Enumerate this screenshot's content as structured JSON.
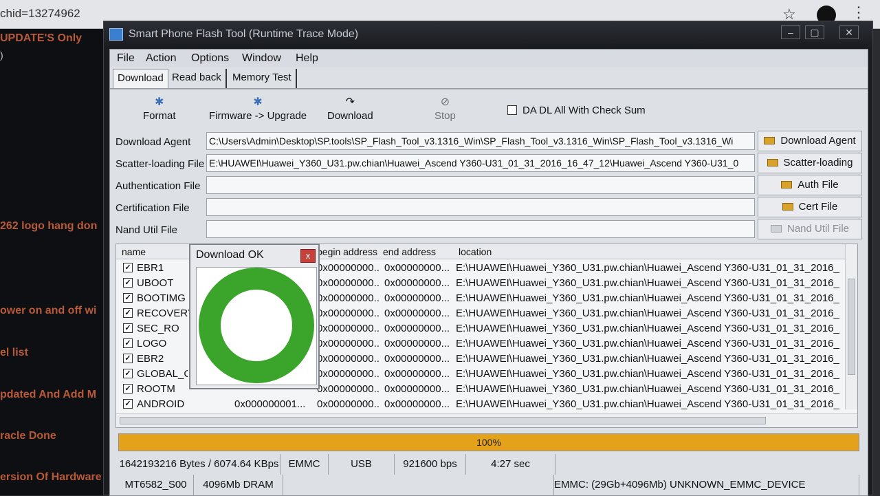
{
  "browser": {
    "url_fragment": "chid=13274962"
  },
  "forum": {
    "lines": [
      {
        "text": "UPDATE'S Only"
      },
      {
        "text": ")"
      },
      {
        "text": "262 logo hang don"
      },
      {
        "text": "ower on and off wi"
      },
      {
        "text": "el list"
      },
      {
        "text": "pdated And Add M"
      },
      {
        "text": "racle Done"
      },
      {
        "text": "ersion Of Hardware"
      }
    ]
  },
  "window": {
    "title": "Smart Phone Flash Tool (Runtime Trace Mode)"
  },
  "menu": [
    "File",
    "Action",
    "Options",
    "Window",
    "Help"
  ],
  "tabs": [
    "Download",
    "Read back",
    "Memory Test"
  ],
  "toolbar": {
    "format": "Format",
    "firmware_upgrade": "Firmware -> Upgrade",
    "download": "Download",
    "stop": "Stop",
    "checksum_label": "DA DL All With Check Sum"
  },
  "files": [
    {
      "label": "Download Agent",
      "value": "C:\\Users\\Admin\\Desktop\\SP.tools\\SP_Flash_Tool_v3.1316_Win\\SP_Flash_Tool_v3.1316_Win\\SP_Flash_Tool_v3.1316_Wi",
      "button": "Download Agent"
    },
    {
      "label": "Scatter-loading File",
      "value": "E:\\HUAWEI\\Huawei_Y360_U31.pw.chian\\Huawei_Ascend Y360-U31_01_31_2016_16_47_12\\Huawei_Ascend Y360-U31_0",
      "button": "Scatter-loading"
    },
    {
      "label": "Authentication File",
      "value": "",
      "button": "Auth File"
    },
    {
      "label": "Certification File",
      "value": "",
      "button": "Cert File"
    },
    {
      "label": "Nand Util File",
      "value": "",
      "button": "Nand Util File"
    }
  ],
  "table": {
    "headers": [
      "name",
      "begin address",
      "end address",
      "location"
    ],
    "rows": [
      {
        "name": "EBR1",
        "begin": "0x00000000...",
        "end": "0x00000000...",
        "location": "E:\\HUAWEI\\Huawei_Y360_U31.pw.chian\\Huawei_Ascend Y360-U31_01_31_2016_16_"
      },
      {
        "name": "UBOOT",
        "begin": "0x00000000...",
        "end": "0x00000000...",
        "location": "E:\\HUAWEI\\Huawei_Y360_U31.pw.chian\\Huawei_Ascend Y360-U31_01_31_2016_16_"
      },
      {
        "name": "BOOTIMG",
        "begin": "0x00000000...",
        "end": "0x00000000...",
        "location": "E:\\HUAWEI\\Huawei_Y360_U31.pw.chian\\Huawei_Ascend Y360-U31_01_31_2016_16_"
      },
      {
        "name": "RECOVERY",
        "begin": "0x00000000...",
        "end": "0x00000000...",
        "location": "E:\\HUAWEI\\Huawei_Y360_U31.pw.chian\\Huawei_Ascend Y360-U31_01_31_2016_16_"
      },
      {
        "name": "SEC_RO",
        "begin": "0x00000000...",
        "end": "0x00000000...",
        "location": "E:\\HUAWEI\\Huawei_Y360_U31.pw.chian\\Huawei_Ascend Y360-U31_01_31_2016_16_"
      },
      {
        "name": "LOGO",
        "begin": "0x00000000...",
        "end": "0x00000000...",
        "location": "E:\\HUAWEI\\Huawei_Y360_U31.pw.chian\\Huawei_Ascend Y360-U31_01_31_2016_16_"
      },
      {
        "name": "EBR2",
        "begin": "0x00000000...",
        "end": "0x00000000...",
        "location": "E:\\HUAWEI\\Huawei_Y360_U31.pw.chian\\Huawei_Ascend Y360-U31_01_31_2016_16_"
      },
      {
        "name": "GLOBAL_C",
        "begin": "0x00000000...",
        "end": "0x00000000...",
        "location": "E:\\HUAWEI\\Huawei_Y360_U31.pw.chian\\Huawei_Ascend Y360-U31_01_31_2016_16_"
      },
      {
        "name": "ROOTM",
        "begin": "0x00000000...",
        "end": "0x00000000...",
        "location": "E:\\HUAWEI\\Huawei_Y360_U31.pw.chian\\Huawei_Ascend Y360-U31_01_31_2016_16_"
      },
      {
        "name": "ANDROID",
        "size": "0x000000001...",
        "begin": "0x00000000...",
        "end": "0x00000000...",
        "location": "E:\\HUAWEI\\Huawei_Y360_U31.pw.chian\\Huawei_Ascend Y360-U31_01_31_2016_16_"
      }
    ]
  },
  "progress": {
    "value": 1.0,
    "label": "100%",
    "color": "#e3a21a"
  },
  "status1": [
    "1642193216 Bytes / 6074.64 KBps",
    "EMMC",
    "USB",
    "921600 bps",
    "4:27 sec"
  ],
  "status2": [
    "MT6582_S00",
    "4096Mb DRAM",
    "EMMC: (29Gb+4096Mb) UNKNOWN_EMMC_DEVICE"
  ],
  "dialog": {
    "title": "Download OK",
    "close": "x",
    "ring_color": "#3aa52a"
  }
}
